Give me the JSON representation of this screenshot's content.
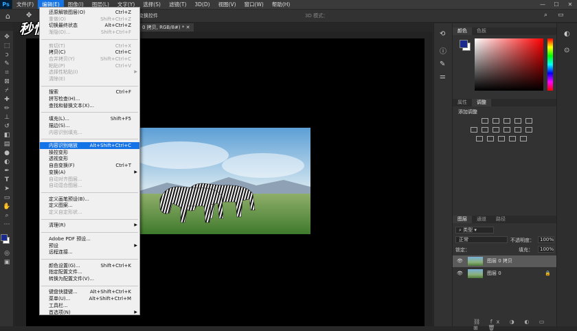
{
  "app": {
    "logo": "Ps"
  },
  "menubar": {
    "items": [
      "文件(F)",
      "编辑(E)",
      "图像(I)",
      "图层(L)",
      "文字(Y)",
      "选择(S)",
      "滤镜(T)",
      "3D(D)",
      "视图(V)",
      "窗口(W)",
      "帮助(H)"
    ],
    "active_index": 1
  },
  "options_bar": {
    "transform_controls": "变换控件",
    "mode_3d": "3D 模式："
  },
  "document_tab": {
    "title": "0 拷贝, RGB/8#) *"
  },
  "watermark": {
    "text": "秒懂视频"
  },
  "edit_menu": {
    "items": [
      {
        "label": "还原解锁图层(O)",
        "shortcut": "Ctrl+Z",
        "y": 0,
        "disabled": false
      },
      {
        "label": "重做(O)",
        "shortcut": "Shift+Ctrl+Z",
        "y": 1,
        "disabled": true
      },
      {
        "label": "切换最终状态",
        "shortcut": "Alt+Ctrl+Z",
        "y": 2,
        "disabled": false
      },
      {
        "label": "渐隐(D)...",
        "shortcut": "Shift+Ctrl+F",
        "y": 3,
        "disabled": true
      },
      {
        "label": "剪切(T)",
        "shortcut": "Ctrl+X",
        "y": 5,
        "disabled": true
      },
      {
        "label": "拷贝(C)",
        "shortcut": "Ctrl+C",
        "y": 6,
        "disabled": false
      },
      {
        "label": "合并拷贝(Y)",
        "shortcut": "Shift+Ctrl+C",
        "y": 7,
        "disabled": true
      },
      {
        "label": "粘贴(P)",
        "shortcut": "Ctrl+V",
        "y": 8,
        "disabled": true
      },
      {
        "label": "选择性粘贴(I)",
        "shortcut": "",
        "y": 9,
        "disabled": true,
        "arrow": true
      },
      {
        "label": "清除(E)",
        "shortcut": "",
        "y": 10,
        "disabled": true
      },
      {
        "label": "搜索",
        "shortcut": "Ctrl+F",
        "y": 12,
        "disabled": false
      },
      {
        "label": "拼写检查(H)...",
        "shortcut": "",
        "y": 13,
        "disabled": false
      },
      {
        "label": "查找和替换文本(X)...",
        "shortcut": "",
        "y": 14,
        "disabled": false
      },
      {
        "label": "填充(L)...",
        "shortcut": "Shift+F5",
        "y": 16,
        "disabled": false
      },
      {
        "label": "描边(S)...",
        "shortcut": "",
        "y": 17,
        "disabled": false
      },
      {
        "label": "内容识别填充...",
        "shortcut": "",
        "y": 18,
        "disabled": true
      },
      {
        "label": "内容识别缩放",
        "shortcut": "Alt+Shift+Ctrl+C",
        "y": 20,
        "disabled": false,
        "highlight": true
      },
      {
        "label": "操控变形",
        "shortcut": "",
        "y": 21,
        "disabled": false
      },
      {
        "label": "透视变形",
        "shortcut": "",
        "y": 22,
        "disabled": false
      },
      {
        "label": "自由变换(F)",
        "shortcut": "Ctrl+T",
        "y": 23,
        "disabled": false
      },
      {
        "label": "变换(A)",
        "shortcut": "",
        "y": 24,
        "disabled": false,
        "arrow": true
      },
      {
        "label": "自动对齐图层...",
        "shortcut": "",
        "y": 25,
        "disabled": true
      },
      {
        "label": "自动混合图层...",
        "shortcut": "",
        "y": 26,
        "disabled": true
      },
      {
        "label": "定义画笔预设(B)...",
        "shortcut": "",
        "y": 28,
        "disabled": false
      },
      {
        "label": "定义图案...",
        "shortcut": "",
        "y": 29,
        "disabled": false
      },
      {
        "label": "定义自定形状...",
        "shortcut": "",
        "y": 30,
        "disabled": true
      },
      {
        "label": "清理(R)",
        "shortcut": "",
        "y": 32,
        "disabled": false,
        "arrow": true
      },
      {
        "label": "Adobe PDF 预设...",
        "shortcut": "",
        "y": 34,
        "disabled": false
      },
      {
        "label": "预设",
        "shortcut": "",
        "y": 35,
        "disabled": false,
        "arrow": true
      },
      {
        "label": "远程连接...",
        "shortcut": "",
        "y": 36,
        "disabled": false
      },
      {
        "label": "颜色设置(G)...",
        "shortcut": "Shift+Ctrl+K",
        "y": 38,
        "disabled": false
      },
      {
        "label": "指定配置文件...",
        "shortcut": "",
        "y": 39,
        "disabled": false
      },
      {
        "label": "转换为配置文件(V)...",
        "shortcut": "",
        "y": 40,
        "disabled": false
      },
      {
        "label": "键盘快捷键...",
        "shortcut": "Alt+Shift+Ctrl+K",
        "y": 42,
        "disabled": false
      },
      {
        "label": "菜单(U)...",
        "shortcut": "Alt+Shift+Ctrl+M",
        "y": 43,
        "disabled": false
      },
      {
        "label": "工具栏...",
        "shortcut": "",
        "y": 44,
        "disabled": false
      },
      {
        "label": "首选项(N)",
        "shortcut": "",
        "y": 45,
        "disabled": false,
        "arrow": true
      }
    ],
    "separators": [
      4,
      11,
      15,
      19,
      27,
      31,
      33,
      37,
      41
    ]
  },
  "color_panel": {
    "tabs": [
      "颜色",
      "色板"
    ],
    "foreground": "#1a2a8c",
    "background": "#ffffff"
  },
  "adjustments_panel": {
    "tabs": [
      "属性",
      "调整"
    ],
    "heading": "添加调整"
  },
  "layers_panel": {
    "tabs": [
      "图层",
      "通道",
      "路径"
    ],
    "filter_label": "类型",
    "blend_mode": "正常",
    "opacity_label": "不透明度：",
    "opacity": "100%",
    "lock_label": "锁定：",
    "fill_label": "填充：",
    "fill": "100%",
    "layers": [
      {
        "name": "图层 0 拷贝",
        "selected": true
      },
      {
        "name": "图层 0",
        "selected": false
      }
    ]
  }
}
